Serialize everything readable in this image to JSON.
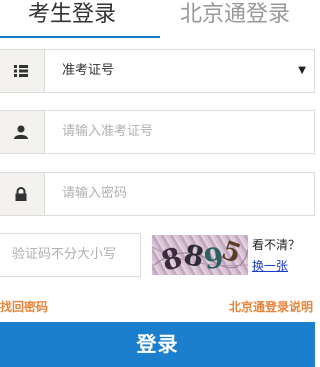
{
  "tabs": {
    "active": "考生登录",
    "inactive": "北京通登录"
  },
  "form": {
    "id_type": {
      "icon": "list-icon",
      "value": "准考证号",
      "caret": "▼"
    },
    "exam_number": {
      "icon": "user-icon",
      "placeholder": "请输入准考证号"
    },
    "password": {
      "icon": "lock-icon",
      "placeholder": "请输入密码"
    },
    "captcha": {
      "placeholder": "验证码不分大小写",
      "code": "8895",
      "cant_see": "看不清？",
      "refresh": "换一张"
    }
  },
  "links": {
    "forgot_password": "找回密码",
    "bjt_help": "北京通登录说明"
  },
  "submit_label": "登录",
  "colors": {
    "accent": "#1b7fce",
    "link_orange": "#e8843a",
    "tab_underline": "#1a77c9"
  }
}
